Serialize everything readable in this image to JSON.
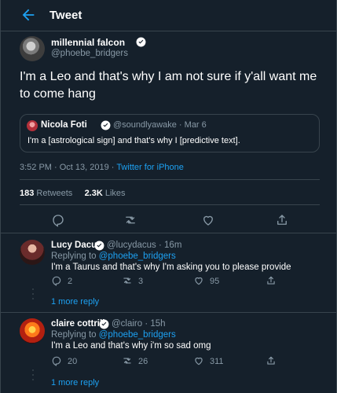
{
  "header": {
    "title": "Tweet"
  },
  "tweet": {
    "name": "millennial falcon",
    "handle": "@phoebe_bridgers",
    "text": "I'm a Leo and that's why I am not sure if y'all want me to come hang",
    "quote": {
      "name": "Nicola Foti",
      "handle": "@soundlyawake · Mar 6",
      "text": "I'm a [astrological sign] and that's why I [predictive text]."
    },
    "timestamp": "3:52 PM · Oct 13, 2019 · ",
    "source": "Twitter for iPhone",
    "retweets": "183",
    "retweets_label": " Retweets",
    "likes": "2.3K",
    "likes_label": " Likes"
  },
  "replies": [
    {
      "name": "Lucy Dacus",
      "handle": "@lucydacus · 16m",
      "replying_prefix": "Replying to ",
      "replying_to": "@phoebe_bridgers",
      "text": "I'm a Taurus and that's why I'm asking you to please provide",
      "reply_count": "2",
      "retweet_count": "3",
      "like_count": "95",
      "more": "1 more reply"
    },
    {
      "name": "claire cottrill",
      "handle": "@clairo · 15h",
      "replying_prefix": "Replying to ",
      "replying_to": "@phoebe_bridgers",
      "text": "I'm a Leo and that's why i'm so sad omg",
      "reply_count": "20",
      "retweet_count": "26",
      "like_count": "311",
      "more": "1 more reply"
    }
  ],
  "icons": {
    "back": "arrow-left-icon",
    "verified": "verified-badge-icon",
    "reply": "comment-icon",
    "retweet": "retweet-icon",
    "like": "heart-icon",
    "share": "share-icon"
  },
  "colors": {
    "background": "#15202b",
    "border": "#38444d",
    "accent": "#1da1f2",
    "secondary_text": "#8899a6"
  }
}
